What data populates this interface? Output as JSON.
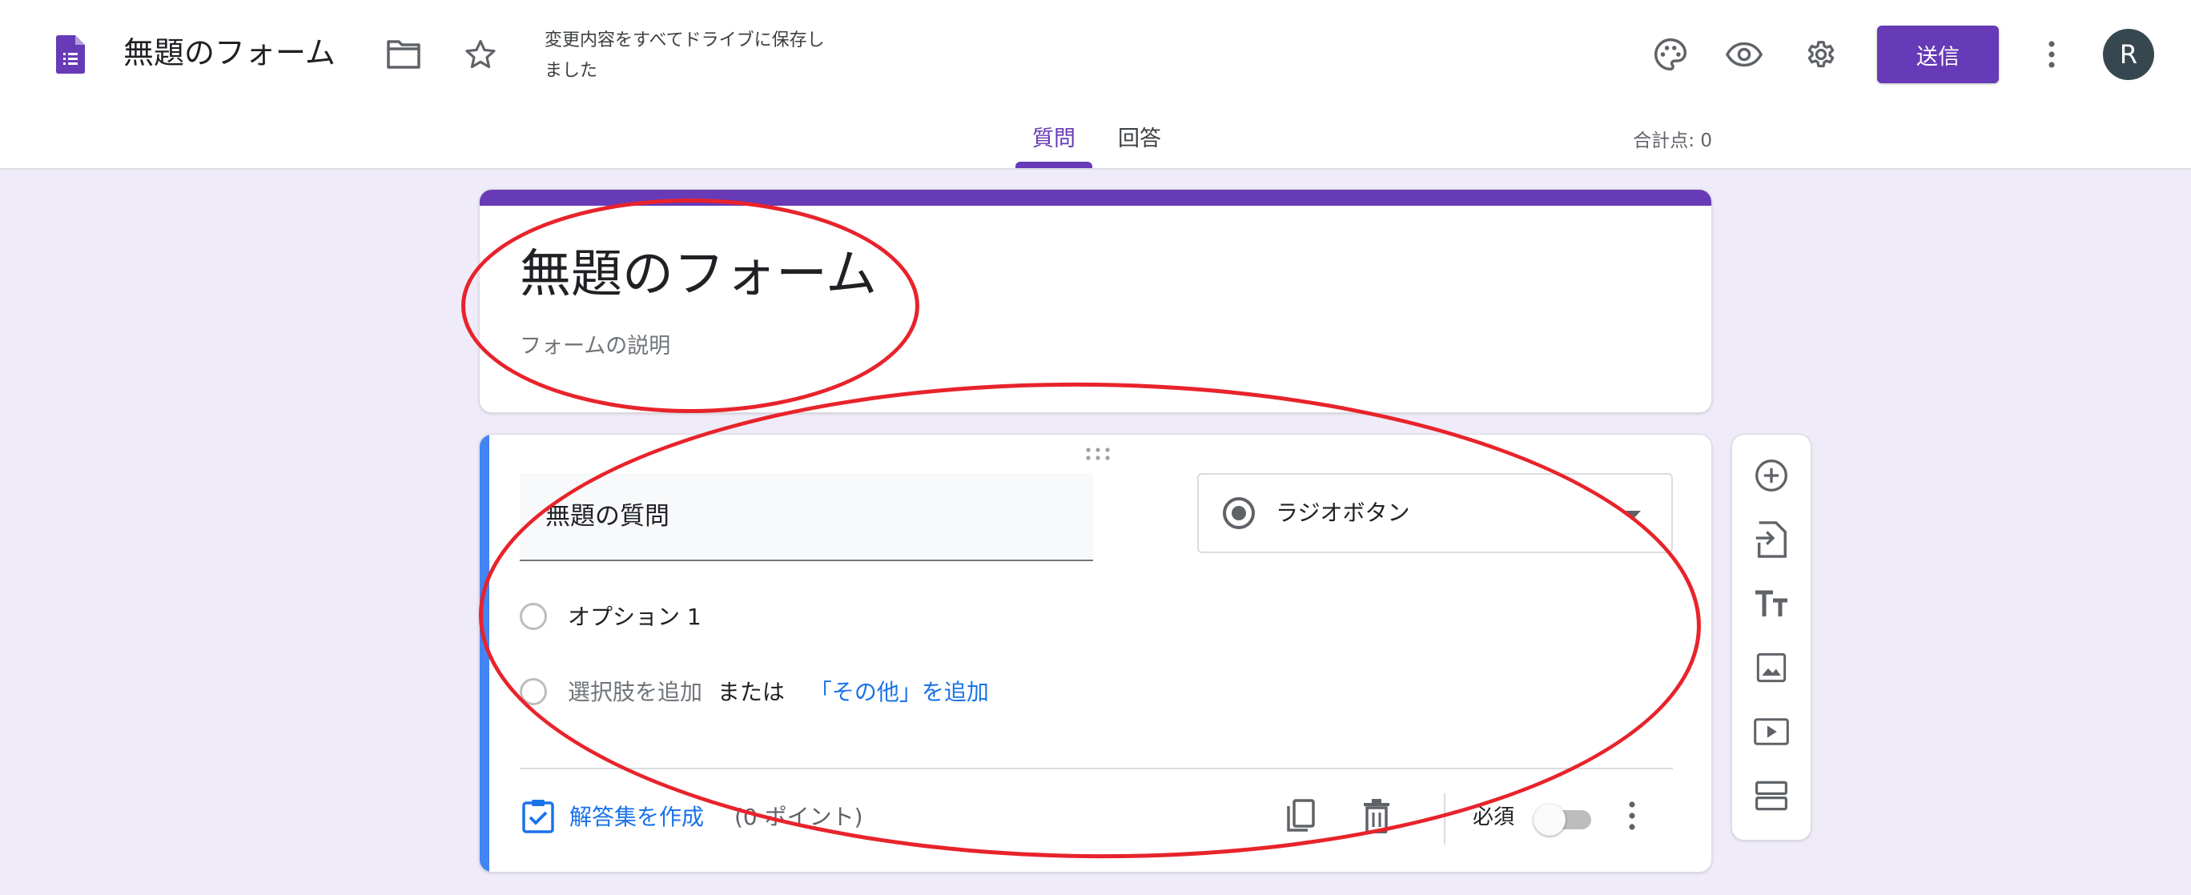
{
  "header": {
    "doc_title": "無題のフォーム",
    "save_status": "変更内容をすべてドライブに保存しました",
    "send_label": "送信",
    "avatar_initial": "R",
    "icons": [
      "forms-logo-icon",
      "folder-icon",
      "star-icon",
      "palette-icon",
      "preview-eye-icon",
      "settings-gear-icon",
      "more-vert-icon"
    ]
  },
  "tabs": [
    {
      "label": "質問",
      "active": true
    },
    {
      "label": "回答",
      "active": false
    }
  ],
  "total_points": "合計点: 0",
  "title_card": {
    "title": "無題のフォーム",
    "description_placeholder": "フォームの説明"
  },
  "question_card": {
    "title": "無題の質問",
    "type": "ラジオボタン",
    "options": [
      "オプション 1"
    ],
    "add_option": "選択肢を追加",
    "or_text": "または",
    "add_other": "「その他」を追加",
    "answer_key": "解答集を作成",
    "points": "(0 ポイント)",
    "required_label": "必須",
    "required": false
  },
  "side_toolbar": [
    "add-question-icon",
    "import-questions-icon",
    "add-title-text-icon",
    "add-image-icon",
    "add-video-icon",
    "add-section-icon"
  ],
  "colors": {
    "accent": "#673ab7",
    "background": "#f0ebf8",
    "question_accent": "#4285f4",
    "link": "#1a73e8",
    "annotation": "#e8232b"
  }
}
